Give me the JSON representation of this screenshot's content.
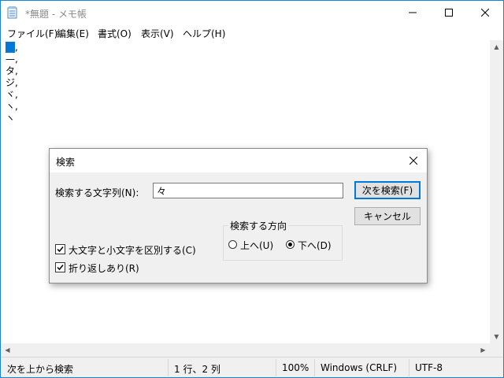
{
  "window": {
    "title": "*無題 - メモ帳"
  },
  "menu": [
    "ファイル(F)",
    "編集(E)",
    "書式(O)",
    "表示(V)",
    "ヘルプ(H)"
  ],
  "editor": {
    "lines": [
      "　,",
      "—,",
      "タ,",
      "ジ,",
      "ヾ,",
      "ヽ,",
      "ヽ"
    ],
    "selected_line": 0
  },
  "status": {
    "message": "次を上から検索",
    "position": "1 行、2 列",
    "zoom": "100%",
    "line_ending": "Windows (CRLF)",
    "encoding": "UTF-8"
  },
  "find_dialog": {
    "title": "検索",
    "find_label": "検索する文字列(N):",
    "find_value": "々",
    "find_next_button": "次を検索(F)",
    "cancel_button": "キャンセル",
    "direction_legend": "検索する方向",
    "direction_up": "上へ(U)",
    "direction_down": "下へ(D)",
    "direction_selected": "down",
    "match_case_label": "大文字と小文字を区別する(C)",
    "match_case": true,
    "wrap_label": "折り返しあり(R)",
    "wrap": true
  }
}
